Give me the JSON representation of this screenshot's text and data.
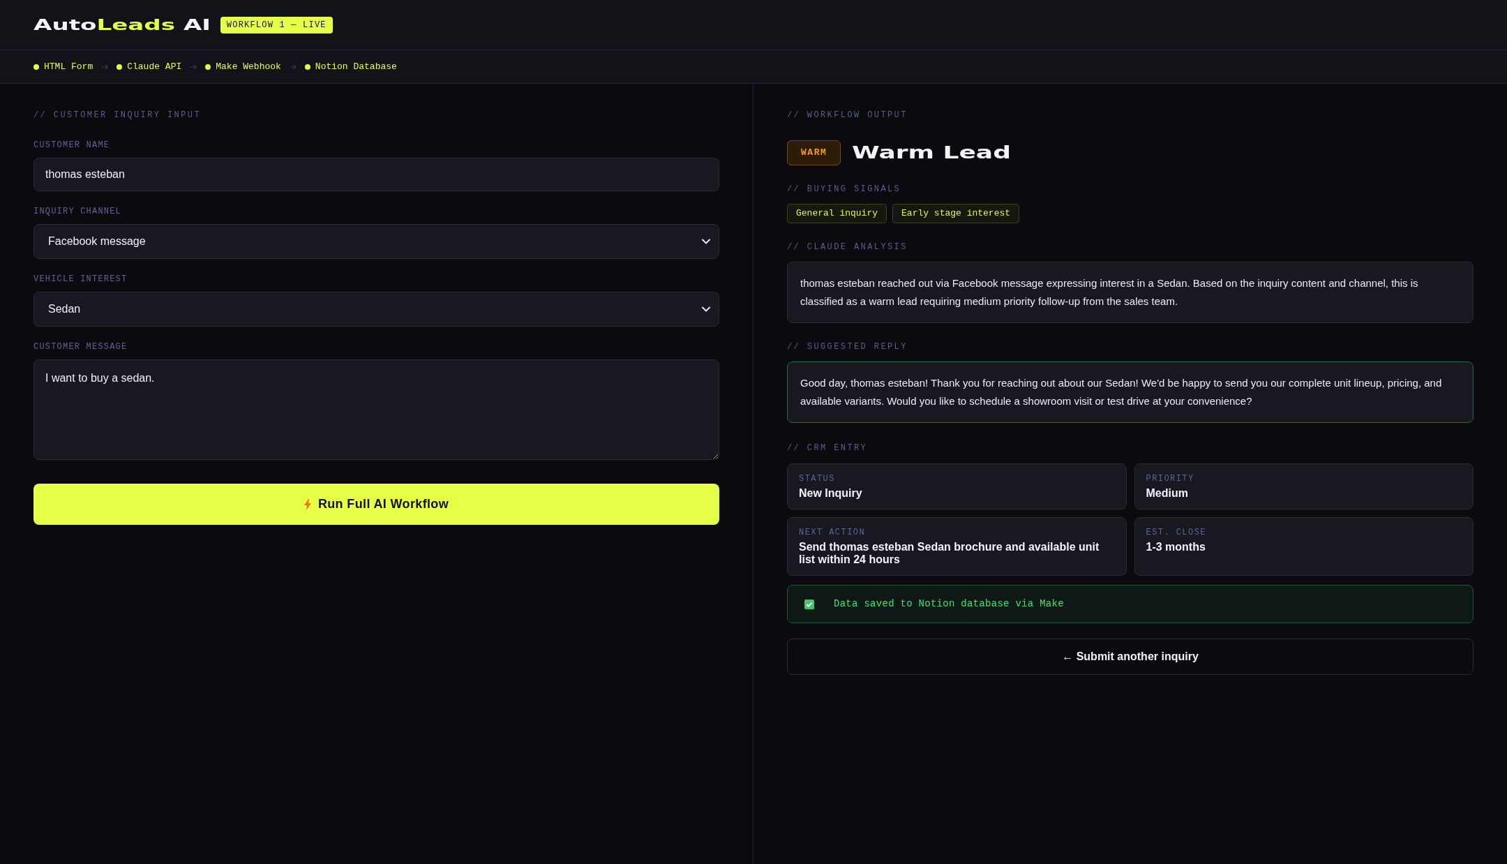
{
  "header": {
    "logo": [
      {
        "parts": [
          {
            "text": "Auto",
            "highlight": false
          },
          {
            "text": "Leads",
            "highlight": true
          }
        ]
      },
      {
        "parts": [
          {
            "text": "AI",
            "highlight": false
          }
        ]
      }
    ],
    "badge": "WORKFLOW 1 — LIVE"
  },
  "pipeline": [
    {
      "label": "HTML Form"
    },
    {
      "label": "Claude API"
    },
    {
      "label": "Make Webhook"
    },
    {
      "label": "Notion Database"
    }
  ],
  "form": {
    "section_title": "// CUSTOMER INQUIRY INPUT",
    "fields": [
      {
        "kind": "text",
        "label": "CUSTOMER NAME",
        "value": "thomas esteban"
      },
      {
        "kind": "select",
        "label": "INQUIRY CHANNEL",
        "value": "Facebook message"
      },
      {
        "kind": "select",
        "label": "VEHICLE INTEREST",
        "value": "Sedan"
      },
      {
        "kind": "textarea",
        "label": "CUSTOMER MESSAGE",
        "value": "I want to buy a sedan."
      }
    ],
    "submit_button": "Run Full AI Workflow"
  },
  "output": {
    "section_title": "// WORKFLOW OUTPUT",
    "lead": {
      "kind": "warm",
      "badge": "WARM",
      "title": "Warm Lead"
    },
    "buying_signals": {
      "title": "// BUYING SIGNALS",
      "tags": [
        "General inquiry",
        "Early stage interest"
      ]
    },
    "analysis": {
      "title": "// CLAUDE ANALYSIS",
      "text": "thomas esteban reached out via Facebook message expressing interest in a Sedan. Based on the inquiry content and channel, this is classified as a warm lead requiring medium priority follow-up from the sales team."
    },
    "suggested_reply": {
      "title": "// SUGGESTED REPLY",
      "text": "Good day, thomas esteban! Thank you for reaching out about our Sedan! We'd be happy to send you our complete unit lineup, pricing, and available variants. Would you like to schedule a showroom visit or test drive at your convenience?"
    },
    "crm_entry": {
      "title": "// CRM ENTRY",
      "fields": [
        {
          "label": "STATUS",
          "value": "New Inquiry"
        },
        {
          "label": "PRIORITY",
          "value": "Medium"
        },
        {
          "label": "NEXT ACTION",
          "value": "Send thomas esteban Sedan brochure and available unit list within 24 hours"
        },
        {
          "label": "EST. CLOSE",
          "value": "1-3 months"
        }
      ]
    },
    "saved_notice": "Data saved to Notion database via Make",
    "back_button": "← Submit another inquiry"
  }
}
